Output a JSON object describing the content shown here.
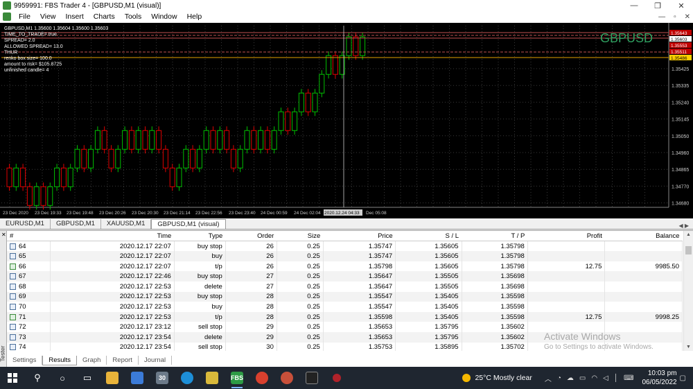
{
  "window": {
    "title": "9959991: FBS Trader 4 - [GBPUSD,M1 (visual)]",
    "controls": [
      "—",
      "❐",
      "✕"
    ]
  },
  "menu": {
    "items": [
      "File",
      "View",
      "Insert",
      "Charts",
      "Tools",
      "Window",
      "Help"
    ],
    "mdi_controls": [
      "—",
      "▫",
      "✕"
    ]
  },
  "chart": {
    "symbol_watermark": "GBPUSD",
    "header_lines": [
      "GBPUSD,M1  1.35600 1.35604 1.35600 1.35603",
      "TIME_TO_TRADE= true",
      "SPREAD= 2.0",
      "ALLOWED SPREAD= 13.0",
      "THUR",
      "renko box size= 100.0",
      "amount to risk= $105.8725",
      "unfinished candle= 4"
    ],
    "price_labels": [
      "1.35425",
      "1.35335",
      "1.35240",
      "1.35145",
      "1.35050",
      "1.34960",
      "1.34865",
      "1.34770",
      "1.34680"
    ],
    "current_price_tags": [
      "1.35643",
      "1.35603",
      "1.35553",
      "1.35511",
      "1.35486"
    ],
    "time_labels": [
      "23 Dec 2020",
      "23 Dec 19:33",
      "23 Dec 19:48",
      "23 Dec 20:26",
      "23 Dec 20:30",
      "23 Dec 21:14",
      "23 Dec 22:56",
      "23 Dec 23:40",
      "24 Dec 00:59",
      "24 Dec 02:04",
      "2020.12.24 04:33",
      "Dec 05:08"
    ],
    "colors": {
      "background": "#000000",
      "bull": "#00c000",
      "bear": "#e00000",
      "grid": "#3a3a3a"
    },
    "price_range": [
      1.3468,
      1.3565
    ],
    "candles": [
      {
        "o": 1.3489,
        "c": 1.3479,
        "bull": false
      },
      {
        "o": 1.3479,
        "c": 1.3489,
        "bull": true
      },
      {
        "o": 1.3489,
        "c": 1.3479,
        "bull": false
      },
      {
        "o": 1.3479,
        "c": 1.3469,
        "bull": false
      },
      {
        "o": 1.3469,
        "c": 1.3479,
        "bull": true
      },
      {
        "o": 1.3479,
        "c": 1.3469,
        "bull": false
      },
      {
        "o": 1.3469,
        "c": 1.3479,
        "bull": true
      },
      {
        "o": 1.3479,
        "c": 1.3489,
        "bull": true
      },
      {
        "o": 1.3489,
        "c": 1.3479,
        "bull": false
      },
      {
        "o": 1.3479,
        "c": 1.3489,
        "bull": true
      },
      {
        "o": 1.3489,
        "c": 1.3499,
        "bull": true
      },
      {
        "o": 1.3499,
        "c": 1.3489,
        "bull": false
      },
      {
        "o": 1.3489,
        "c": 1.3499,
        "bull": true
      },
      {
        "o": 1.3499,
        "c": 1.3509,
        "bull": true
      },
      {
        "o": 1.3509,
        "c": 1.3499,
        "bull": false
      },
      {
        "o": 1.3499,
        "c": 1.3489,
        "bull": false
      },
      {
        "o": 1.3489,
        "c": 1.3499,
        "bull": true
      },
      {
        "o": 1.3499,
        "c": 1.3509,
        "bull": true
      },
      {
        "o": 1.3509,
        "c": 1.3499,
        "bull": false
      },
      {
        "o": 1.3499,
        "c": 1.3509,
        "bull": true
      },
      {
        "o": 1.3509,
        "c": 1.3499,
        "bull": false
      },
      {
        "o": 1.3499,
        "c": 1.3509,
        "bull": true
      },
      {
        "o": 1.3509,
        "c": 1.3499,
        "bull": false
      },
      {
        "o": 1.3499,
        "c": 1.3489,
        "bull": false
      },
      {
        "o": 1.3489,
        "c": 1.3479,
        "bull": false
      },
      {
        "o": 1.3479,
        "c": 1.3489,
        "bull": true
      },
      {
        "o": 1.3489,
        "c": 1.3499,
        "bull": true
      },
      {
        "o": 1.3499,
        "c": 1.3489,
        "bull": false
      },
      {
        "o": 1.3489,
        "c": 1.3499,
        "bull": true
      },
      {
        "o": 1.3499,
        "c": 1.3509,
        "bull": true
      },
      {
        "o": 1.3509,
        "c": 1.3499,
        "bull": false
      },
      {
        "o": 1.3499,
        "c": 1.3509,
        "bull": true
      },
      {
        "o": 1.3509,
        "c": 1.3499,
        "bull": false
      },
      {
        "o": 1.3499,
        "c": 1.3489,
        "bull": false
      },
      {
        "o": 1.3489,
        "c": 1.3499,
        "bull": true
      },
      {
        "o": 1.3499,
        "c": 1.3509,
        "bull": true
      },
      {
        "o": 1.3509,
        "c": 1.3499,
        "bull": false
      },
      {
        "o": 1.3499,
        "c": 1.3509,
        "bull": true
      },
      {
        "o": 1.3509,
        "c": 1.3499,
        "bull": false
      },
      {
        "o": 1.3499,
        "c": 1.3509,
        "bull": true
      },
      {
        "o": 1.3509,
        "c": 1.3519,
        "bull": true
      },
      {
        "o": 1.3519,
        "c": 1.3509,
        "bull": false
      },
      {
        "o": 1.3509,
        "c": 1.3519,
        "bull": true
      },
      {
        "o": 1.3519,
        "c": 1.3529,
        "bull": true
      },
      {
        "o": 1.3529,
        "c": 1.3519,
        "bull": false
      },
      {
        "o": 1.3519,
        "c": 1.3529,
        "bull": true
      },
      {
        "o": 1.3529,
        "c": 1.3539,
        "bull": true
      },
      {
        "o": 1.3539,
        "c": 1.3549,
        "bull": true
      },
      {
        "o": 1.3549,
        "c": 1.3539,
        "bull": false
      },
      {
        "o": 1.3539,
        "c": 1.3549,
        "bull": true
      },
      {
        "o": 1.3549,
        "c": 1.3559,
        "bull": true
      },
      {
        "o": 1.3559,
        "c": 1.3549,
        "bull": false
      },
      {
        "o": 1.3549,
        "c": 1.3559,
        "bull": true
      }
    ]
  },
  "chart_tabs": [
    {
      "label": "EURUSD,M1",
      "active": false
    },
    {
      "label": "GBPUSD,M1",
      "active": false
    },
    {
      "label": "XAUUSD,M1",
      "active": false
    },
    {
      "label": "GBPUSD,M1 (visual)",
      "active": true
    }
  ],
  "results": {
    "columns": [
      "#",
      "Time",
      "Type",
      "Order",
      "Size",
      "Price",
      "S / L",
      "T / P",
      "Profit",
      "Balance"
    ],
    "rows": [
      {
        "n": "64",
        "time": "2020.12.17 22:07",
        "type": "buy stop",
        "order": "26",
        "size": "0.25",
        "price": "1.35747",
        "sl": "1.35605",
        "tp": "1.35798",
        "profit": "",
        "balance": ""
      },
      {
        "n": "65",
        "time": "2020.12.17 22:07",
        "type": "buy",
        "order": "26",
        "size": "0.25",
        "price": "1.35747",
        "sl": "1.35605",
        "tp": "1.35798",
        "profit": "",
        "balance": ""
      },
      {
        "n": "66",
        "time": "2020.12.17 22:07",
        "type": "t/p",
        "order": "26",
        "size": "0.25",
        "price": "1.35798",
        "sl": "1.35605",
        "tp": "1.35798",
        "profit": "12.75",
        "balance": "9985.50"
      },
      {
        "n": "67",
        "time": "2020.12.17 22:46",
        "type": "buy stop",
        "order": "27",
        "size": "0.25",
        "price": "1.35647",
        "sl": "1.35505",
        "tp": "1.35698",
        "profit": "",
        "balance": ""
      },
      {
        "n": "68",
        "time": "2020.12.17 22:53",
        "type": "delete",
        "order": "27",
        "size": "0.25",
        "price": "1.35647",
        "sl": "1.35505",
        "tp": "1.35698",
        "profit": "",
        "balance": ""
      },
      {
        "n": "69",
        "time": "2020.12.17 22:53",
        "type": "buy stop",
        "order": "28",
        "size": "0.25",
        "price": "1.35547",
        "sl": "1.35405",
        "tp": "1.35598",
        "profit": "",
        "balance": ""
      },
      {
        "n": "70",
        "time": "2020.12.17 22:53",
        "type": "buy",
        "order": "28",
        "size": "0.25",
        "price": "1.35547",
        "sl": "1.35405",
        "tp": "1.35598",
        "profit": "",
        "balance": ""
      },
      {
        "n": "71",
        "time": "2020.12.17 22:53",
        "type": "t/p",
        "order": "28",
        "size": "0.25",
        "price": "1.35598",
        "sl": "1.35405",
        "tp": "1.35598",
        "profit": "12.75",
        "balance": "9998.25"
      },
      {
        "n": "72",
        "time": "2020.12.17 23:12",
        "type": "sell stop",
        "order": "29",
        "size": "0.25",
        "price": "1.35653",
        "sl": "1.35795",
        "tp": "1.35602",
        "profit": "",
        "balance": ""
      },
      {
        "n": "73",
        "time": "2020.12.17 23:54",
        "type": "delete",
        "order": "29",
        "size": "0.25",
        "price": "1.35653",
        "sl": "1.35795",
        "tp": "1.35602",
        "profit": "",
        "balance": ""
      },
      {
        "n": "74",
        "time": "2020.12.17 23:54",
        "type": "sell stop",
        "order": "30",
        "size": "0.25",
        "price": "1.35753",
        "sl": "1.35895",
        "tp": "1.35702",
        "profit": "",
        "balance": ""
      }
    ]
  },
  "bottom_tabs": [
    {
      "label": "Settings",
      "active": false
    },
    {
      "label": "Results",
      "active": true
    },
    {
      "label": "Graph",
      "active": false
    },
    {
      "label": "Report",
      "active": false
    },
    {
      "label": "Journal",
      "active": false
    }
  ],
  "tester_label": "Tester",
  "tester_close": "✕",
  "watermark": {
    "line1": "Activate Windows",
    "line2": "Go to Settings to activate Windows."
  },
  "taskbar": {
    "badge": "30",
    "fbs_label": "FBS",
    "weather": "25°C  Mostly clear",
    "time": "10:03 pm",
    "date": "06/05/2022"
  }
}
